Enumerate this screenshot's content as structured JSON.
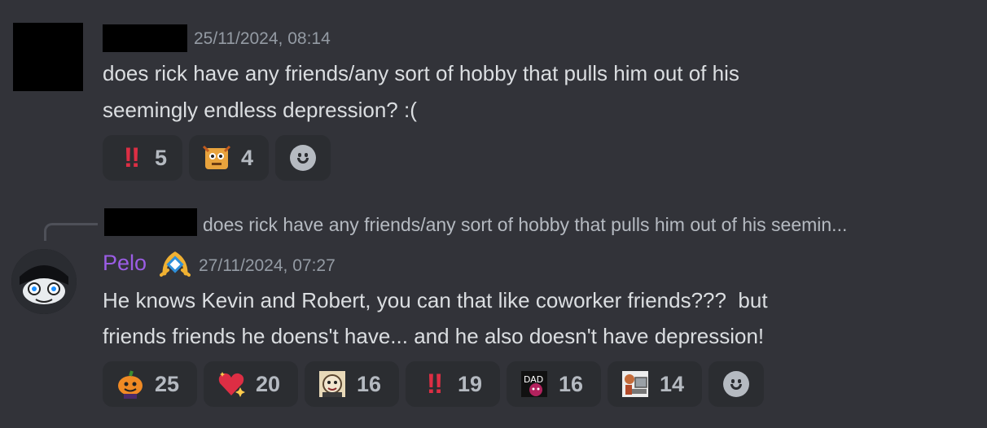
{
  "message1": {
    "timestamp": "25/11/2024, 08:14",
    "text_line1": "does rick have any friends/any sort of hobby that pulls him out of his",
    "text_line2": "seemingly endless depression? :(",
    "reactions": [
      {
        "emoji": "double-exclamation-icon",
        "count": "5"
      },
      {
        "emoji": "character-sticker-icon",
        "count": "4"
      }
    ]
  },
  "reply": {
    "quoted_text": "does rick have any friends/any sort of hobby that pulls him out of his seemin..."
  },
  "message2": {
    "author": "Pelo",
    "author_color": "#9b5de5",
    "timestamp": "27/11/2024, 07:27",
    "text_line1": "He knows Kevin and Robert, you can that like coworker friends???  but",
    "text_line2": "friends friends he doens't have... and he also doesn't have depression!",
    "reactions": [
      {
        "emoji": "pumpkin-character-icon",
        "count": "25"
      },
      {
        "emoji": "sparkling-heart-icon",
        "count": "20"
      },
      {
        "emoji": "character-face-icon",
        "count": "16"
      },
      {
        "emoji": "double-exclamation-icon",
        "count": "19"
      },
      {
        "emoji": "dad-character-icon",
        "count": "16"
      },
      {
        "emoji": "computer-character-icon",
        "count": "14"
      }
    ]
  },
  "colors": {
    "background": "#323339",
    "reaction_bg": "#2b2d31",
    "timestamp": "#949ba4"
  }
}
